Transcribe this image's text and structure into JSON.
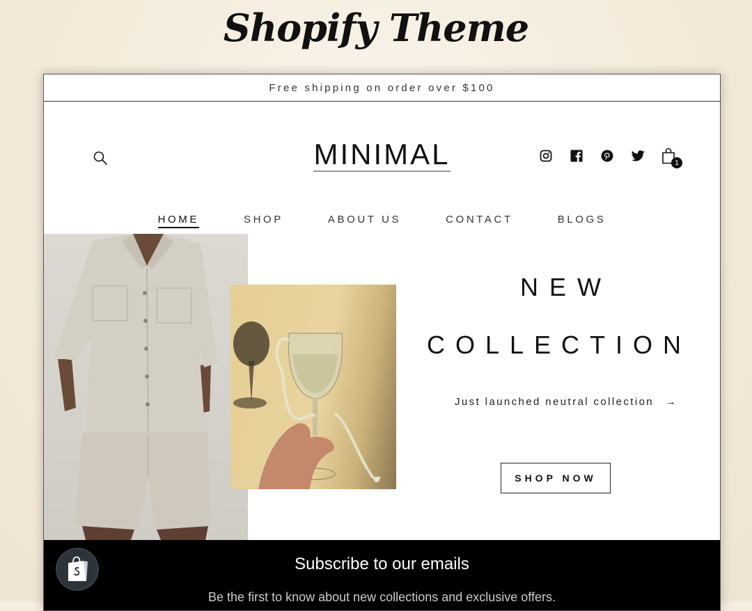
{
  "banner": {
    "title": "Shopify Theme"
  },
  "announcement": {
    "text": "Free shipping on order over $100"
  },
  "header": {
    "logo": "MINIMAL",
    "icons": [
      "search-icon",
      "instagram-icon",
      "facebook-icon",
      "pinterest-icon",
      "twitter-icon",
      "shopping-bag-icon"
    ],
    "cart_count": "1"
  },
  "nav": {
    "items": [
      {
        "label": "HOME",
        "active": true
      },
      {
        "label": "SHOP"
      },
      {
        "label": "ABOUT US"
      },
      {
        "label": "CONTACT"
      },
      {
        "label": "BLOGS"
      }
    ]
  },
  "hero": {
    "title_line1": "NEW",
    "title_line2": "COLLECTION",
    "subtitle": "Just launched neutral collection",
    "subtitle_arrow": "→",
    "cta": "SHOP NOW"
  },
  "footer": {
    "title": "Subscribe to our emails",
    "text": "Be the first to know about new collections and exclusive offers."
  },
  "colors": {
    "page_bg": "#f5ede0",
    "store_bg": "#ffffff",
    "text": "#111111",
    "footer_bg": "#000000",
    "badge_bg": "#2d333b"
  }
}
